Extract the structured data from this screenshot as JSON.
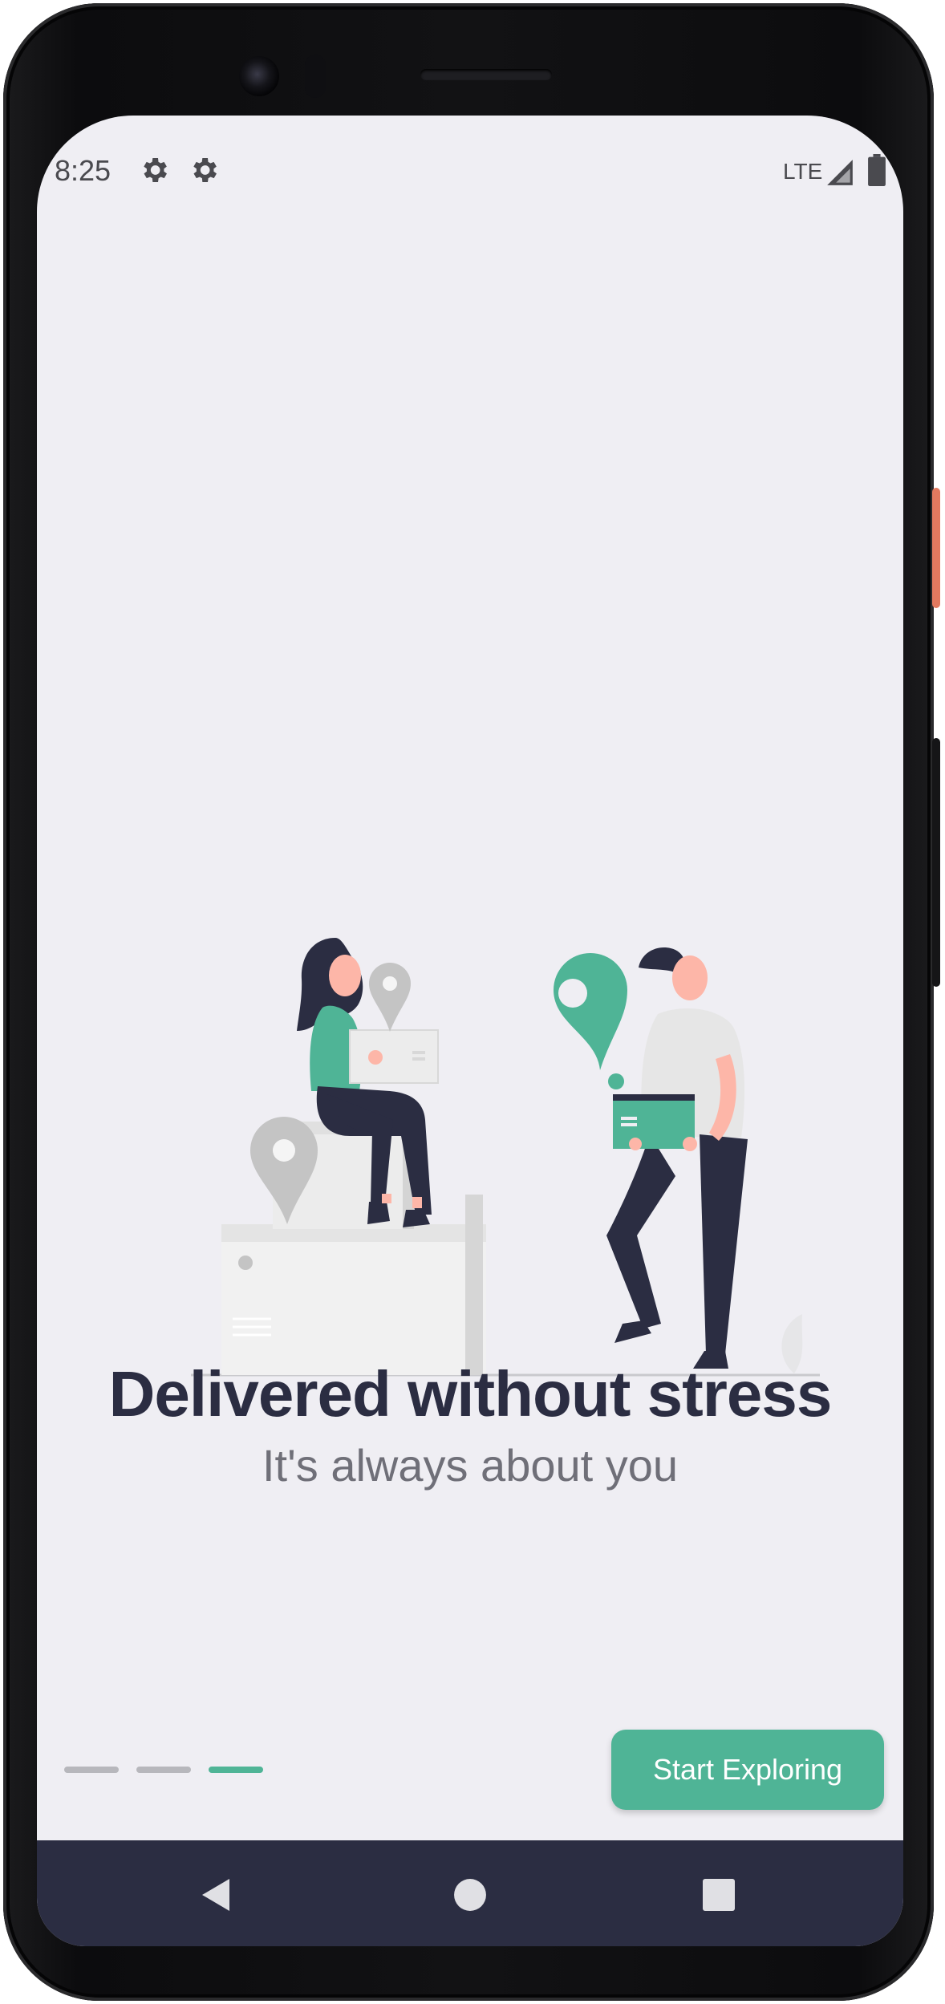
{
  "status_bar": {
    "time": "8:25",
    "network": "LTE",
    "icons": [
      "gear-icon",
      "gear-icon",
      "signal-icon",
      "battery-icon"
    ]
  },
  "onboarding": {
    "title": "Delivered without stress",
    "subtitle": "It's always about you",
    "page_count": 3,
    "active_page": 3,
    "cta_label": "Start Exploring"
  },
  "nav_bar": {
    "icons": [
      "back-icon",
      "home-icon",
      "recents-icon"
    ]
  },
  "colors": {
    "accent": "#4fb496",
    "headline": "#2b2d42",
    "background": "#efeef3",
    "nav_bar": "#2b2d42",
    "inactive_indicator": "#b7b7bc"
  }
}
